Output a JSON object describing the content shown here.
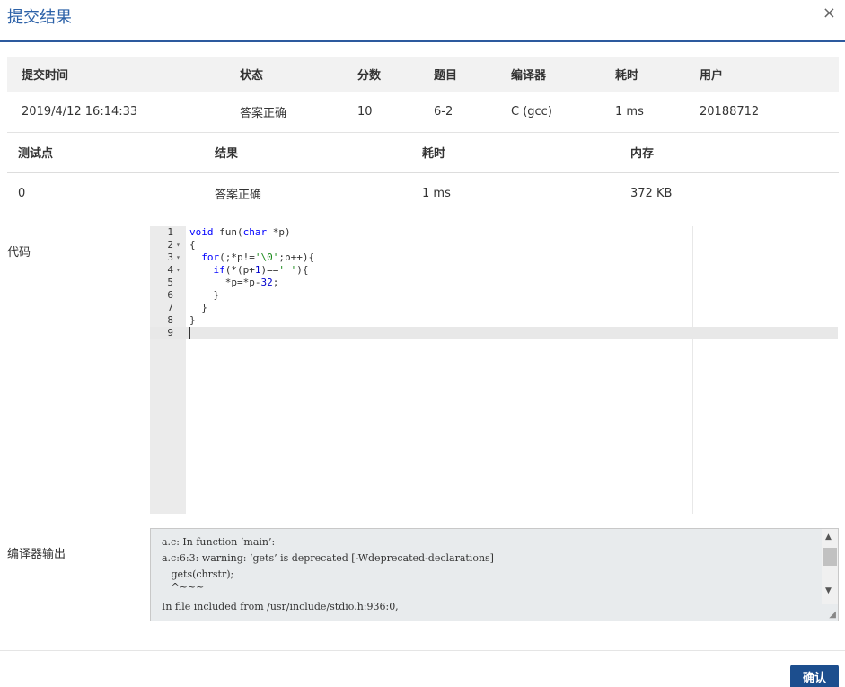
{
  "dialog": {
    "title": "提交结果",
    "close_glyph": "×"
  },
  "submission_table": {
    "headers": [
      "提交时间",
      "状态",
      "分数",
      "题目",
      "编译器",
      "耗时",
      "用户"
    ],
    "row": {
      "time": "2019/4/12 16:14:33",
      "status": "答案正确",
      "score": "10",
      "problem": "6-2",
      "compiler": "C (gcc)",
      "elapsed": "1 ms",
      "user": "20188712"
    }
  },
  "testcase_table": {
    "headers": [
      "测试点",
      "结果",
      "耗时",
      "内存"
    ],
    "row": {
      "case": "0",
      "result": "答案正确",
      "elapsed": "1 ms",
      "memory": "372 KB"
    }
  },
  "code_section": {
    "label": "代码",
    "line_numbers": [
      "1",
      "2",
      "3",
      "4",
      "5",
      "6",
      "7",
      "8",
      "9"
    ],
    "fold_glyph": "▾"
  },
  "compiler_output": {
    "label": "编译器输出",
    "lines": [
      "a.c: In function ‘main’:",
      "a.c:6:3: warning: ‘gets’ is deprecated [-Wdeprecated-declarations]",
      "   gets(chrstr);",
      "   ^~~~",
      "In file included from /usr/include/stdio.h:936:0,"
    ],
    "scroll_up_glyph": "▲",
    "scroll_down_glyph": "▼",
    "resize_glyph": "◢"
  },
  "footer": {
    "confirm_label": "确认"
  },
  "colors": {
    "accent": "#2d62a8",
    "status_ok": "#d9534f",
    "button": "#1c4e8e"
  }
}
